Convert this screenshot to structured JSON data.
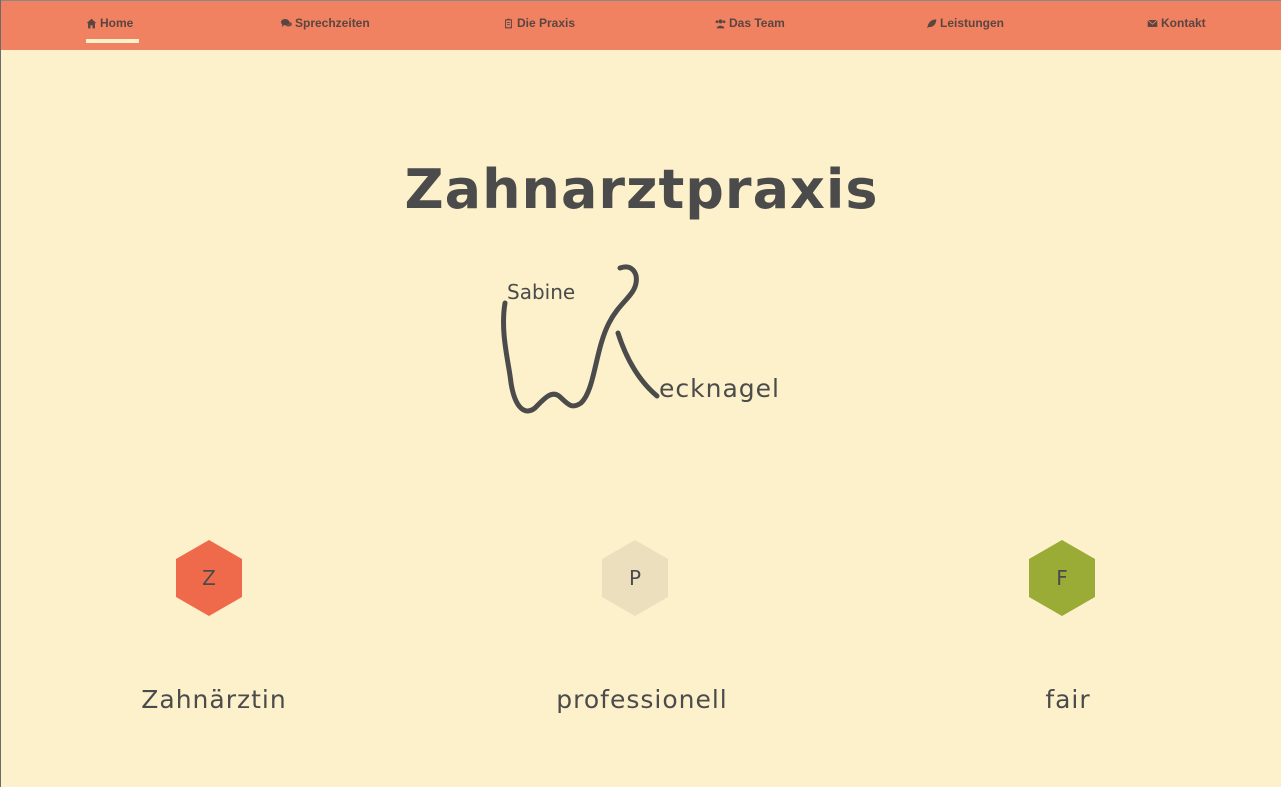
{
  "nav": {
    "items": [
      {
        "label": "Home",
        "icon": "home-icon"
      },
      {
        "label": "Sprechzeiten",
        "icon": "comments-icon"
      },
      {
        "label": "Die Praxis",
        "icon": "clipboard-icon"
      },
      {
        "label": "Das Team",
        "icon": "users-icon"
      },
      {
        "label": "Leistungen",
        "icon": "leaf-icon"
      },
      {
        "label": "Kontakt",
        "icon": "envelope-icon"
      }
    ],
    "active": "Home"
  },
  "hero": {
    "title": "Zahnarztpraxis",
    "logo": {
      "first_name": "Sabine",
      "last_name_rest": "ecknagel"
    }
  },
  "features": [
    {
      "letter": "Z",
      "label": "Zahnärztin",
      "color": "#ef6a4b"
    },
    {
      "letter": "P",
      "label": "professionell",
      "color": "#ebdfbe"
    },
    {
      "letter": "F",
      "label": "fair",
      "color": "#9aab36"
    }
  ],
  "colors": {
    "navbar": "#f08262",
    "background": "#fdf1cb",
    "text": "#4b4b4b"
  }
}
